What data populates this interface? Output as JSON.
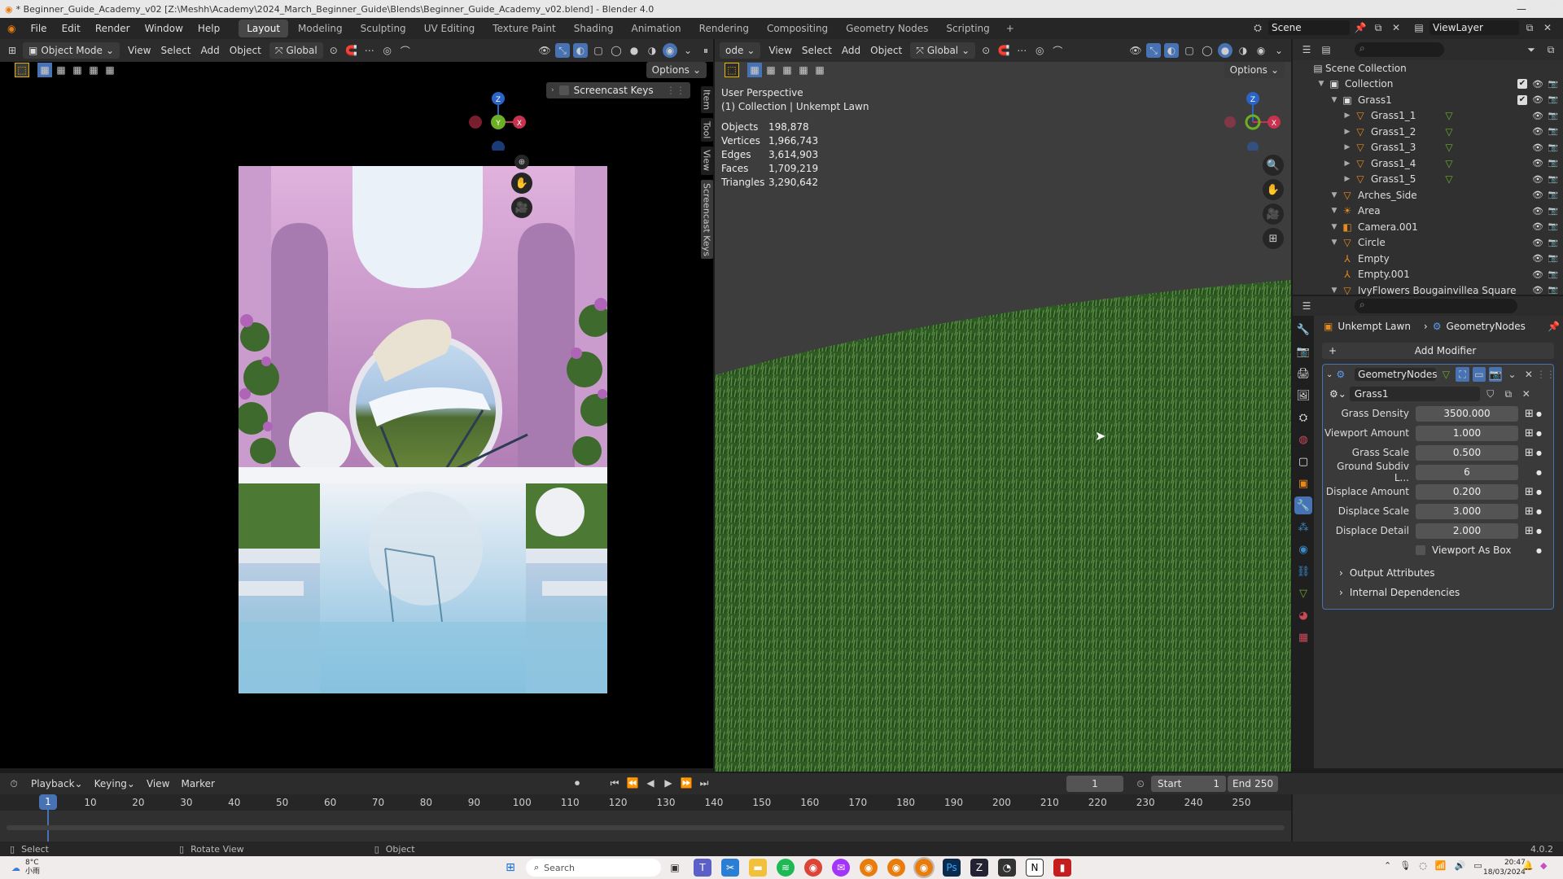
{
  "titlebar": {
    "title": "* Beginner_Guide_Academy_v02 [Z:\\Meshh\\Academy\\2024_March_Beginner_Guide\\Blends\\Beginner_Guide_Academy_v02.blend] - Blender 4.0",
    "min_icon": "minimize-icon",
    "max_icon": "maximize-icon",
    "close_icon": "close-icon"
  },
  "menu": [
    "File",
    "Edit",
    "Render",
    "Window",
    "Help"
  ],
  "workspaces": [
    "Layout",
    "Modeling",
    "Sculpting",
    "UV Editing",
    "Texture Paint",
    "Shading",
    "Animation",
    "Rendering",
    "Compositing",
    "Geometry Nodes",
    "Scripting"
  ],
  "add_workspace": "+",
  "scene": {
    "name": "Scene",
    "viewlayer": "ViewLayer"
  },
  "left_viewport": {
    "mode": "Object Mode",
    "menus": [
      "View",
      "Select",
      "Add",
      "Object"
    ],
    "transform": "Global",
    "options": "Options",
    "screencast_panel": "Screencast Keys",
    "side_tabs": [
      "Item",
      "Tool",
      "View",
      "Screencast Keys"
    ],
    "gizmo": {
      "z": "Z",
      "y": "Y",
      "x": "X"
    }
  },
  "right_viewport": {
    "mode_fragment": "ode",
    "menus": [
      "View",
      "Select",
      "Add",
      "Object"
    ],
    "transform": "Global",
    "options": "Options",
    "perspective": "User Perspective",
    "collection_line": "(1) Collection | Unkempt Lawn",
    "stats": [
      {
        "k": "Objects",
        "v": "198,878"
      },
      {
        "k": "Vertices",
        "v": "1,966,743"
      },
      {
        "k": "Edges",
        "v": "3,614,903"
      },
      {
        "k": "Faces",
        "v": "1,709,219"
      },
      {
        "k": "Triangles",
        "v": "3,290,642"
      }
    ],
    "gizmo": {
      "z": "Z",
      "y": "Y",
      "x": "X"
    }
  },
  "outliner": {
    "root": "Scene Collection",
    "items": [
      {
        "label": "Collection",
        "depth": 0,
        "icon": "collection-icon",
        "checkbox": true
      },
      {
        "label": "Grass1",
        "depth": 1,
        "icon": "collection-icon",
        "checkbox": true
      },
      {
        "label": "Grass1_1",
        "depth": 2,
        "icon": "mesh-icon"
      },
      {
        "label": "Grass1_2",
        "depth": 2,
        "icon": "mesh-icon"
      },
      {
        "label": "Grass1_3",
        "depth": 2,
        "icon": "mesh-icon"
      },
      {
        "label": "Grass1_4",
        "depth": 2,
        "icon": "mesh-icon"
      },
      {
        "label": "Grass1_5",
        "depth": 2,
        "icon": "mesh-icon"
      },
      {
        "label": "Arches_Side",
        "depth": 1,
        "icon": "mesh-icon"
      },
      {
        "label": "Area",
        "depth": 1,
        "icon": "light-icon"
      },
      {
        "label": "Camera.001",
        "depth": 1,
        "icon": "camera-icon"
      },
      {
        "label": "Circle",
        "depth": 1,
        "icon": "mesh-icon"
      },
      {
        "label": "Empty",
        "depth": 1,
        "icon": "empty-icon"
      },
      {
        "label": "Empty.001",
        "depth": 1,
        "icon": "empty-icon"
      },
      {
        "label": "IvyFlowers Bougainvillea Square",
        "depth": 1,
        "icon": "mesh-icon"
      }
    ]
  },
  "properties": {
    "breadcrumb_object": "Unkempt Lawn",
    "breadcrumb_modifier": "GeometryNodes",
    "add_modifier": "Add Modifier",
    "modifier_name": "GeometryNodes",
    "node_group": "Grass1",
    "params": [
      {
        "label": "Grass Density",
        "value": "3500.000"
      },
      {
        "label": "Viewport Amount",
        "value": "1.000"
      },
      {
        "label": "Grass Scale",
        "value": "0.500"
      },
      {
        "label": "Ground Subdiv L...",
        "value": "6"
      },
      {
        "label": "Displace Amount",
        "value": "0.200"
      },
      {
        "label": "Displace Scale",
        "value": "3.000"
      },
      {
        "label": "Displace Detail",
        "value": "2.000"
      }
    ],
    "checkbox_label": "Viewport As Box",
    "subpanels": [
      "Output Attributes",
      "Internal Dependencies"
    ]
  },
  "timeline": {
    "menus": [
      "Playback",
      "Keying",
      "View",
      "Marker"
    ],
    "current_frame": "1",
    "start_label": "Start",
    "start": "1",
    "end_label": "End",
    "end": "250",
    "ticks": [
      "10",
      "20",
      "30",
      "40",
      "50",
      "60",
      "70",
      "80",
      "90",
      "100",
      "110",
      "120",
      "130",
      "140",
      "150",
      "160",
      "170",
      "180",
      "190",
      "200",
      "210",
      "220",
      "230",
      "240",
      "250"
    ],
    "playhead": "1"
  },
  "statusbar": {
    "select": "Select",
    "rotate": "Rotate View",
    "object": "Object",
    "version": "4.0.2"
  },
  "taskbar": {
    "temp": "8°C",
    "weather": "小雨",
    "search": "Search",
    "time": "20:47",
    "date": "18/03/2024"
  }
}
